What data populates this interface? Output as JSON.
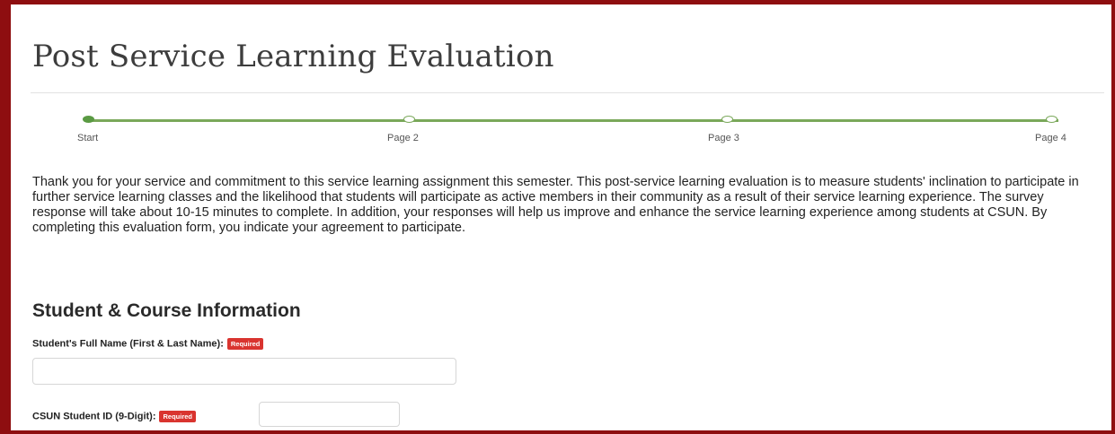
{
  "form": {
    "title": "Post Service Learning Evaluation",
    "steps": [
      "Start",
      "Page 2",
      "Page 3",
      "Page 4"
    ],
    "current_step": 0,
    "intro": "Thank you for your service and commitment to this service learning assignment this semester. This post-service learning evaluation is to measure students' inclination to participate in further service learning classes and the likelihood that students will participate as active members in their community as a result of their service learning experience. The survey response will take about 10-15 minutes to complete. In addition, your responses will help us improve and enhance the service learning experience among students at CSUN. By completing this evaluation form, you indicate your agreement to participate.",
    "section_title": "Student & Course Information",
    "fields": [
      {
        "label": "Student's Full Name (First & Last Name):",
        "badge": "Required",
        "value": ""
      },
      {
        "label": "CSUN Student ID (9-Digit):",
        "badge": "Required",
        "value": ""
      }
    ]
  },
  "colors": {
    "frame": "#8e0e10",
    "progress": "#7aa85a",
    "required_badge": "#d9342f"
  }
}
